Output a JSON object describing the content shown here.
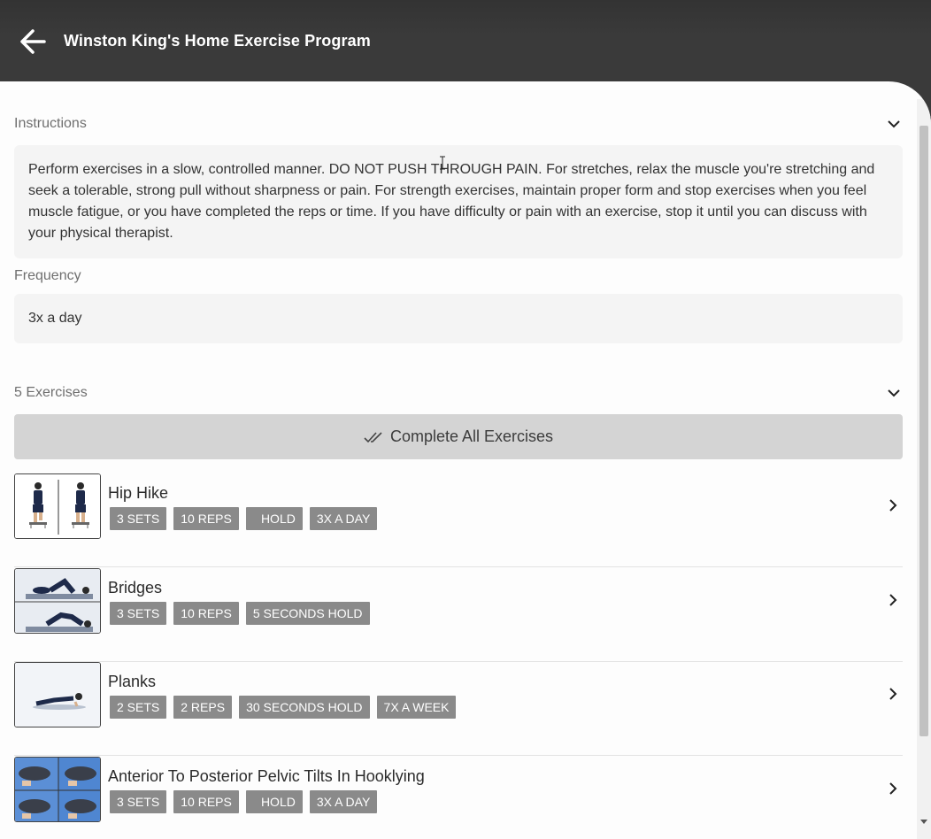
{
  "header": {
    "title": "Winston King's Home Exercise Program"
  },
  "instructions": {
    "label": "Instructions",
    "text": "Perform exercises in a slow, controlled manner. DO NOT PUSH THROUGH PAIN. For stretches, relax the muscle you're stretching and seek a tolerable, strong pull without sharpness or pain. For strength exercises, maintain proper form and stop exercises when you feel muscle fatigue, or you have completed the reps or time. If you have difficulty or pain with an exercise, stop it until you can discuss with your physical therapist."
  },
  "frequency": {
    "label": "Frequency",
    "value": "3x a day"
  },
  "exercises_section": {
    "label": "5 Exercises",
    "complete_all_label": "Complete All Exercises"
  },
  "exercises": [
    {
      "name": "Hip Hike",
      "tags": [
        "3 SETS",
        "10 REPS",
        "HOLD",
        "3X A DAY"
      ]
    },
    {
      "name": "Bridges",
      "tags": [
        "3 SETS",
        "10 REPS",
        "5 SECONDS HOLD"
      ]
    },
    {
      "name": "Planks",
      "tags": [
        "2 SETS",
        "2 REPS",
        "30 SECONDS HOLD",
        "7X A WEEK"
      ]
    },
    {
      "name": "Anterior To Posterior Pelvic Tilts In Hooklying",
      "tags": [
        "3 SETS",
        "10 REPS",
        "HOLD",
        "3X A DAY"
      ]
    }
  ],
  "colors": {
    "header_bg": "#3a3a3a",
    "tag_bg": "#8a8a8a",
    "button_bg": "#d4d4d4",
    "box_bg": "#f4f4f4"
  },
  "icons": {
    "back": "arrow-left-icon",
    "collapse": "chevron-down-icon",
    "complete": "double-check-icon",
    "row_open": "chevron-right-icon"
  }
}
